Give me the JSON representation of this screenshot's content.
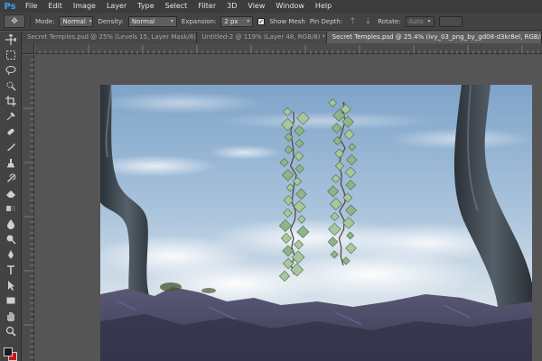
{
  "app": {
    "logo": "Ps"
  },
  "menu": [
    "File",
    "Edit",
    "Image",
    "Layer",
    "Type",
    "Select",
    "Filter",
    "3D",
    "View",
    "Window",
    "Help"
  ],
  "options": {
    "tool_icon": "puppet-warp-icon",
    "mode_label": "Mode:",
    "mode_value": "Normal",
    "density_label": "Density:",
    "density_value": "Normal",
    "expansion_label": "Expansion:",
    "expansion_value": "2 px",
    "show_mesh_label": "Show Mesh",
    "show_mesh_checked": true,
    "pin_depth_label": "Pin Depth:",
    "rotate_label": "Rotate:",
    "rotate_value": "Auto"
  },
  "tabs": [
    {
      "label": "Secret Temples.psd @ 25% (Levels 15, Layer Mask/8) *",
      "active": false
    },
    {
      "label": "Untitled-2 @ 119% (Layer 48, RGB/8) *",
      "active": false
    },
    {
      "label": "Secret Temples.psd @ 25.4% (ivy_03_png_by_gd08-d3kr8el, RGB/8) *",
      "active": true
    }
  ],
  "tools": [
    "move-icon",
    "marquee-icon",
    "lasso-icon",
    "quick-select-icon",
    "crop-icon",
    "eyedropper-icon",
    "spot-heal-icon",
    "brush-icon",
    "clone-stamp-icon",
    "history-brush-icon",
    "eraser-icon",
    "gradient-icon",
    "blur-icon",
    "dodge-icon",
    "pen-icon",
    "type-icon",
    "path-select-icon",
    "rectangle-icon",
    "hand-icon",
    "zoom-icon"
  ],
  "swatch_colors": {
    "foreground": "#1a1a1a",
    "background": "#c81a1a"
  },
  "accent": "#2fa3f5"
}
